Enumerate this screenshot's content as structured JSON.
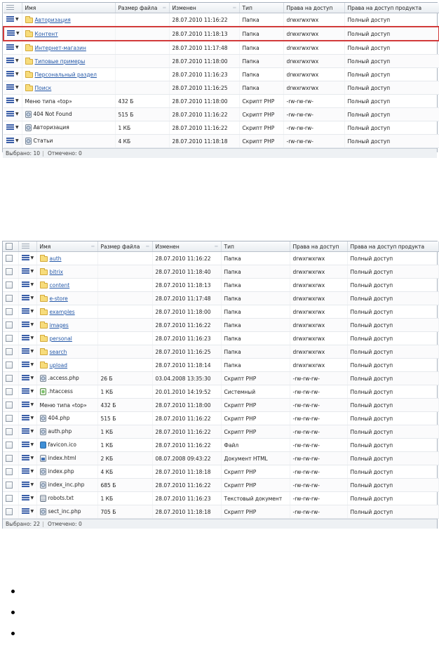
{
  "grid1": {
    "columns": [
      "",
      "Имя",
      "Размер файла",
      "Изменен",
      "Тип",
      "Права на доступ",
      "Права на доступ продукта"
    ],
    "rows": [
      {
        "icon": "folder",
        "link": true,
        "name": "Авторизация",
        "size": "",
        "modified": "28.07.2010 11:16:22",
        "type": "Папка",
        "perms": "drwxrwxrwx",
        "product_perms": "Полный доступ"
      },
      {
        "icon": "folder",
        "link": true,
        "name": "Контент",
        "size": "",
        "modified": "28.07.2010 11:18:13",
        "type": "Папка",
        "perms": "drwxrwxrwx",
        "product_perms": "Полный доступ",
        "highlight": true
      },
      {
        "icon": "folder",
        "link": true,
        "name": "Интернет-магазин",
        "size": "",
        "modified": "28.07.2010 11:17:48",
        "type": "Папка",
        "perms": "drwxrwxrwx",
        "product_perms": "Полный доступ"
      },
      {
        "icon": "folder",
        "link": true,
        "name": "Типовые примеры",
        "size": "",
        "modified": "28.07.2010 11:18:00",
        "type": "Папка",
        "perms": "drwxrwxrwx",
        "product_perms": "Полный доступ"
      },
      {
        "icon": "folder",
        "link": true,
        "name": "Персональный раздел",
        "size": "",
        "modified": "28.07.2010 11:16:23",
        "type": "Папка",
        "perms": "drwxrwxrwx",
        "product_perms": "Полный доступ"
      },
      {
        "icon": "folder",
        "link": true,
        "name": "Поиск",
        "size": "",
        "modified": "28.07.2010 11:16:25",
        "type": "Папка",
        "perms": "drwxrwxrwx",
        "product_perms": "Полный доступ"
      },
      {
        "icon": "none",
        "link": false,
        "name": "Меню типа «top»",
        "size": "432 Б",
        "modified": "28.07.2010 11:18:00",
        "type": "Скрипт PHP",
        "perms": "-rw-rw-rw-",
        "product_perms": "Полный доступ"
      },
      {
        "icon": "php",
        "link": false,
        "name": "404 Not Found",
        "size": "515 Б",
        "modified": "28.07.2010 11:16:22",
        "type": "Скрипт PHP",
        "perms": "-rw-rw-rw-",
        "product_perms": "Полный доступ"
      },
      {
        "icon": "php",
        "link": false,
        "name": "Авторизация",
        "size": "1 КБ",
        "modified": "28.07.2010 11:16:22",
        "type": "Скрипт PHP",
        "perms": "-rw-rw-rw-",
        "product_perms": "Полный доступ"
      },
      {
        "icon": "php",
        "link": false,
        "name": "Статьи",
        "size": "4 КБ",
        "modified": "28.07.2010 11:18:18",
        "type": "Скрипт PHP",
        "perms": "-rw-rw-rw-",
        "product_perms": "Полный доступ"
      }
    ],
    "footer": {
      "selected_label": "Выбрано:",
      "selected_value": "10",
      "checked_label": "Отмечено:",
      "checked_value": "0"
    }
  },
  "grid2": {
    "columns": [
      "",
      "",
      "Имя",
      "Размер файла",
      "Изменен",
      "Тип",
      "Права на доступ",
      "Права на доступ продукта"
    ],
    "rows": [
      {
        "icon": "folder",
        "link": true,
        "name": "auth",
        "size": "",
        "modified": "28.07.2010 11:16:22",
        "type": "Папка",
        "perms": "drwxrwxrwx",
        "product_perms": "Полный доступ"
      },
      {
        "icon": "folder",
        "link": true,
        "name": "bitrix",
        "size": "",
        "modified": "28.07.2010 11:18:40",
        "type": "Папка",
        "perms": "drwxrwxrwx",
        "product_perms": "Полный доступ"
      },
      {
        "icon": "folder",
        "link": true,
        "name": "content",
        "size": "",
        "modified": "28.07.2010 11:18:13",
        "type": "Папка",
        "perms": "drwxrwxrwx",
        "product_perms": "Полный доступ"
      },
      {
        "icon": "folder",
        "link": true,
        "name": "e-store",
        "size": "",
        "modified": "28.07.2010 11:17:48",
        "type": "Папка",
        "perms": "drwxrwxrwx",
        "product_perms": "Полный доступ"
      },
      {
        "icon": "folder",
        "link": true,
        "name": "examples",
        "size": "",
        "modified": "28.07.2010 11:18:00",
        "type": "Папка",
        "perms": "drwxrwxrwx",
        "product_perms": "Полный доступ"
      },
      {
        "icon": "folder",
        "link": true,
        "name": "images",
        "size": "",
        "modified": "28.07.2010 11:16:22",
        "type": "Папка",
        "perms": "drwxrwxrwx",
        "product_perms": "Полный доступ"
      },
      {
        "icon": "folder",
        "link": true,
        "name": "personal",
        "size": "",
        "modified": "28.07.2010 11:16:23",
        "type": "Папка",
        "perms": "drwxrwxrwx",
        "product_perms": "Полный доступ"
      },
      {
        "icon": "folder",
        "link": true,
        "name": "search",
        "size": "",
        "modified": "28.07.2010 11:16:25",
        "type": "Папка",
        "perms": "drwxrwxrwx",
        "product_perms": "Полный доступ"
      },
      {
        "icon": "folder",
        "link": true,
        "name": "upload",
        "size": "",
        "modified": "28.07.2010 11:18:14",
        "type": "Папка",
        "perms": "drwxrwxrwx",
        "product_perms": "Полный доступ"
      },
      {
        "icon": "php",
        "link": false,
        "name": ".access.php",
        "size": "26 Б",
        "modified": "03.04.2008 13:35:30",
        "type": "Скрипт PHP",
        "perms": "-rw-rw-rw-",
        "product_perms": "Полный доступ"
      },
      {
        "icon": "sys",
        "link": false,
        "name": ".htaccess",
        "size": "1 КБ",
        "modified": "20.01.2010 14:19:52",
        "type": "Системный",
        "perms": "-rw-rw-rw-",
        "product_perms": "Полный доступ"
      },
      {
        "icon": "none",
        "link": false,
        "name": "Меню типа «top»",
        "size": "432 Б",
        "modified": "28.07.2010 11:18:00",
        "type": "Скрипт PHP",
        "perms": "-rw-rw-rw-",
        "product_perms": "Полный доступ"
      },
      {
        "icon": "php",
        "link": false,
        "name": "404.php",
        "size": "515 Б",
        "modified": "28.07.2010 11:16:22",
        "type": "Скрипт PHP",
        "perms": "-rw-rw-rw-",
        "product_perms": "Полный доступ"
      },
      {
        "icon": "php",
        "link": false,
        "name": "auth.php",
        "size": "1 КБ",
        "modified": "28.07.2010 11:16:22",
        "type": "Скрипт PHP",
        "perms": "-rw-rw-rw-",
        "product_perms": "Полный доступ"
      },
      {
        "icon": "ico",
        "link": false,
        "name": "favicon.ico",
        "size": "1 КБ",
        "modified": "28.07.2010 11:16:22",
        "type": "Файл",
        "perms": "-rw-rw-rw-",
        "product_perms": "Полный доступ"
      },
      {
        "icon": "html",
        "link": false,
        "name": "index.html",
        "size": "2 КБ",
        "modified": "08.07.2008 09:43:22",
        "type": "Документ HTML",
        "perms": "-rw-rw-rw-",
        "product_perms": "Полный доступ"
      },
      {
        "icon": "php",
        "link": false,
        "name": "index.php",
        "size": "4 КБ",
        "modified": "28.07.2010 11:18:18",
        "type": "Скрипт PHP",
        "perms": "-rw-rw-rw-",
        "product_perms": "Полный доступ"
      },
      {
        "icon": "php",
        "link": false,
        "name": "index_inc.php",
        "size": "685 Б",
        "modified": "28.07.2010 11:16:22",
        "type": "Скрипт PHP",
        "perms": "-rw-rw-rw-",
        "product_perms": "Полный доступ"
      },
      {
        "icon": "txt",
        "link": false,
        "name": "robots.txt",
        "size": "1 КБ",
        "modified": "28.07.2010 11:16:23",
        "type": "Текстовый документ",
        "perms": "-rw-rw-rw-",
        "product_perms": "Полный доступ"
      },
      {
        "icon": "php",
        "link": false,
        "name": "sect_inc.php",
        "size": "705 Б",
        "modified": "28.07.2010 11:18:18",
        "type": "Скрипт PHP",
        "perms": "-rw-rw-rw-",
        "product_perms": "Полный доступ"
      }
    ],
    "footer": {
      "selected_label": "Выбрано:",
      "selected_value": "22",
      "checked_label": "Отмечено:",
      "checked_value": "0"
    }
  },
  "bullets": [
    "",
    "",
    ""
  ],
  "colors": {
    "highlight_border": "#d23b3b",
    "link": "#2458a8",
    "menu_icon": "#3b5fa8"
  }
}
